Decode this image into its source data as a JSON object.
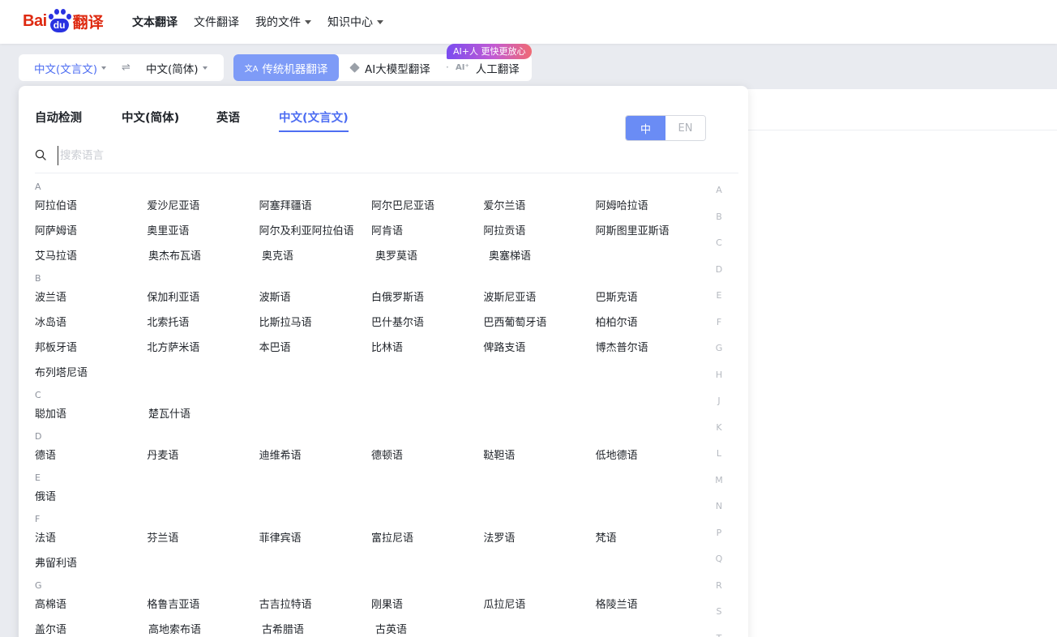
{
  "header": {
    "logo": {
      "text_left": "Bai",
      "paw_text": "du",
      "text_right": "翻译"
    },
    "nav": [
      {
        "label": "文本翻译",
        "active": true,
        "dropdown": false
      },
      {
        "label": "文件翻译",
        "active": false,
        "dropdown": false
      },
      {
        "label": "我的文件",
        "active": false,
        "dropdown": true
      },
      {
        "label": "知识中心",
        "active": false,
        "dropdown": true
      }
    ]
  },
  "toolbar": {
    "source_lang": "中文(文言文)",
    "swap_icon": "⇌",
    "target_lang": "中文(简体)",
    "modes": {
      "traditional": "传统机器翻译",
      "llm": "AI大模型翻译",
      "separator": "·",
      "human_icon": "AI⁺",
      "human": "人工翻译"
    },
    "badge": "AI+人 更快更放心"
  },
  "dropdown": {
    "tabs": [
      "自动检测",
      "中文(简体)",
      "英语",
      "中文(文言文)"
    ],
    "active_tab": 3,
    "ui_lang": {
      "zh": "中",
      "en": "EN"
    },
    "search_placeholder": "搜索语言",
    "groups": [
      {
        "letter": "A",
        "rows": [
          [
            "阿拉伯语",
            "爱沙尼亚语",
            "阿塞拜疆语",
            "阿尔巴尼亚语",
            "爱尔兰语",
            "阿姆哈拉语"
          ],
          [
            "阿萨姆语",
            "奥里亚语",
            "阿尔及利亚阿拉伯语",
            "阿肯语",
            "阿拉贡语",
            "阿斯图里亚斯语"
          ],
          [
            "艾马拉语",
            "奥杰布瓦语",
            "奥克语",
            "奥罗莫语",
            "奥塞梯语"
          ]
        ]
      },
      {
        "letter": "B",
        "rows": [
          [
            "波兰语",
            "保加利亚语",
            "波斯语",
            "白俄罗斯语",
            "波斯尼亚语",
            "巴斯克语"
          ],
          [
            "冰岛语",
            "北索托语",
            "比斯拉马语",
            "巴什基尔语",
            "巴西葡萄牙语",
            "柏柏尔语"
          ],
          [
            "邦板牙语",
            "北方萨米语",
            "本巴语",
            "比林语",
            "俾路支语",
            "博杰普尔语"
          ],
          [
            "布列塔尼语"
          ]
        ]
      },
      {
        "letter": "C",
        "rows": [
          [
            "聪加语",
            "楚瓦什语"
          ]
        ]
      },
      {
        "letter": "D",
        "rows": [
          [
            "德语",
            "丹麦语",
            "迪维希语",
            "德顿语",
            "鞑靼语",
            "低地德语"
          ]
        ]
      },
      {
        "letter": "E",
        "rows": [
          [
            "俄语"
          ]
        ]
      },
      {
        "letter": "F",
        "rows": [
          [
            "法语",
            "芬兰语",
            "菲律宾语",
            "富拉尼语",
            "法罗语",
            "梵语"
          ],
          [
            "弗留利语"
          ]
        ]
      },
      {
        "letter": "G",
        "rows": [
          [
            "高棉语",
            "格鲁吉亚语",
            "古吉拉特语",
            "刚果语",
            "瓜拉尼语",
            "格陵兰语"
          ],
          [
            "盖尔语",
            "高地索布语",
            "古希腊语",
            "古英语"
          ]
        ]
      }
    ],
    "alpha_index": [
      "A",
      "B",
      "C",
      "D",
      "E",
      "F",
      "G",
      "H",
      "J",
      "K",
      "L",
      "M",
      "N",
      "P",
      "Q",
      "R",
      "S",
      "T"
    ]
  }
}
